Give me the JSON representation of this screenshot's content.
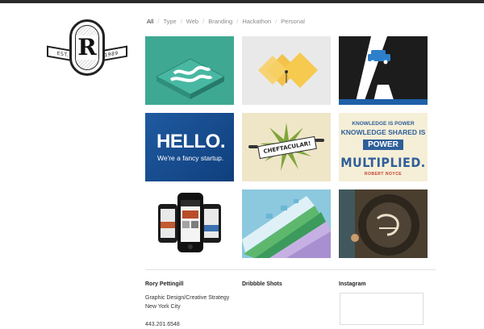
{
  "logo": {
    "letter": "R",
    "est_left": "EST.",
    "est_right": "1989"
  },
  "filters": [
    "All",
    "Type",
    "Web",
    "Branding",
    "Hackathon",
    "Personal"
  ],
  "active_filter": "All",
  "tiles": {
    "hello_title": "HELLO.",
    "hello_sub": "We're a fancy startup.",
    "chef_banner": "CHEFTACULAR!",
    "knowledge_1": "KNOWLEDGE IS POWER",
    "knowledge_2": "KNOWLEDGE SHARED IS",
    "knowledge_3": "POWER",
    "knowledge_4": "MULTIPLIED.",
    "knowledge_5": "ROBERT NOYCE"
  },
  "footer": {
    "name": "Rory Pettingill",
    "role": "Graphic Design/Creative Strategy",
    "city": "New York City",
    "phone": "443.201.6548",
    "dribbble": "Dribbble Shots",
    "instagram": "Instagram"
  }
}
